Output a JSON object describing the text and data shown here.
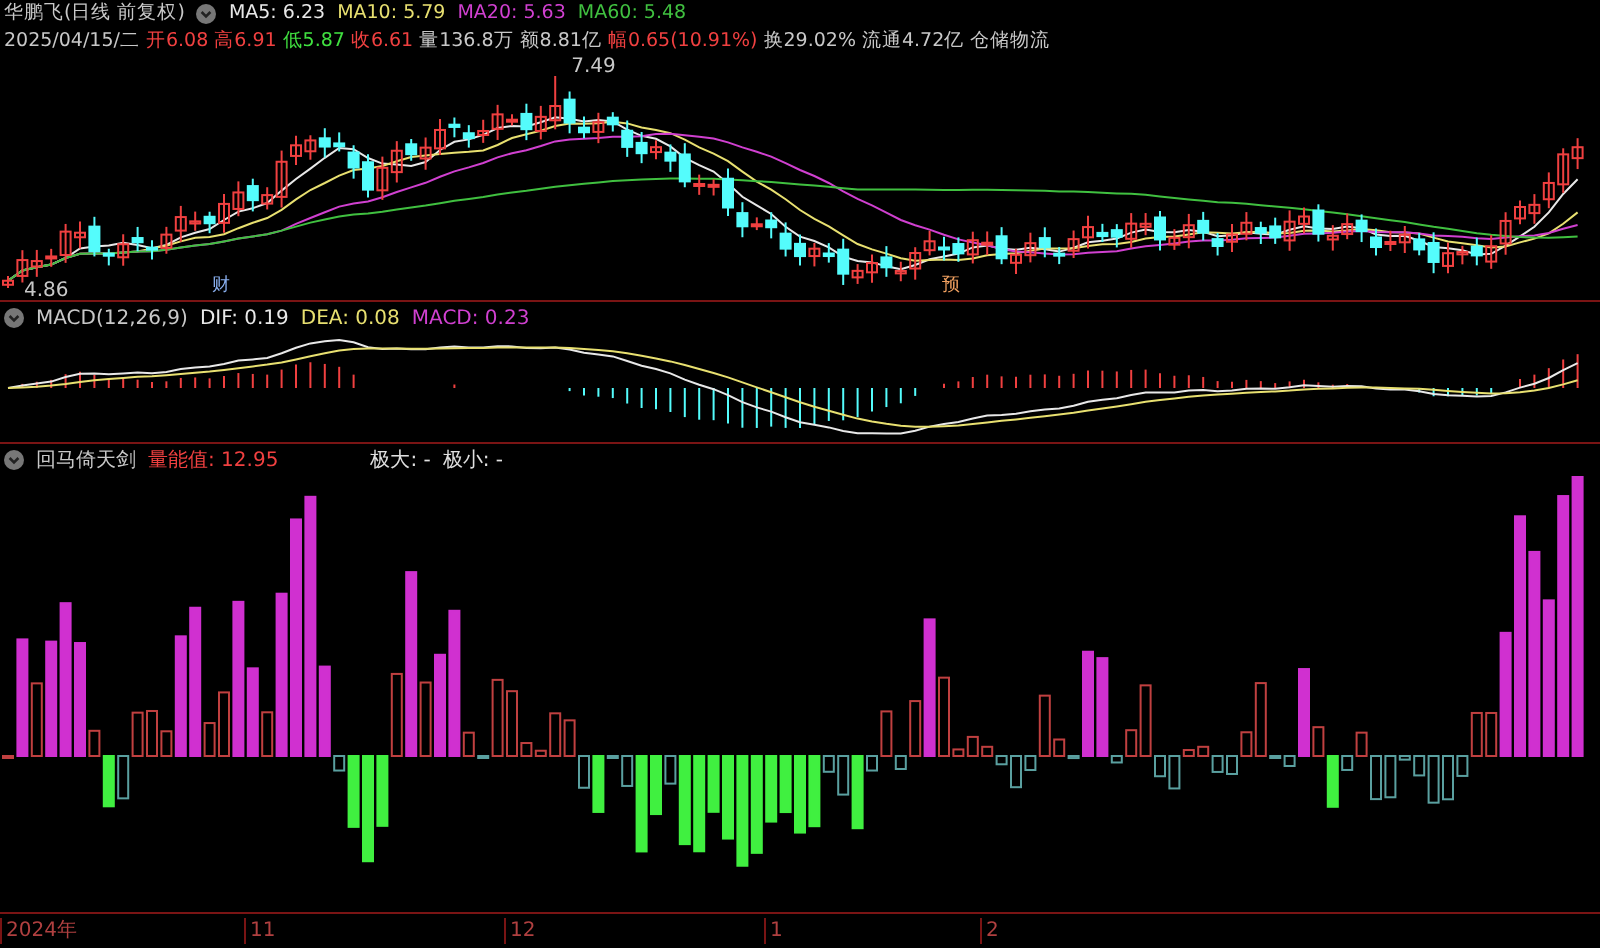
{
  "title": {
    "name": "华鹏飞",
    "period": "(日线 前复权)"
  },
  "ma": [
    {
      "label": "MA5: 6.23",
      "color": "#e8e8e8"
    },
    {
      "label": "MA10: 5.79",
      "color": "#e8e070"
    },
    {
      "label": "MA20: 5.63",
      "color": "#d040d0"
    },
    {
      "label": "MA60: 5.48",
      "color": "#40c040"
    }
  ],
  "quote": [
    {
      "label": "2025/04/15/二",
      "color": "#c8c8c8"
    },
    {
      "label": "开6.08",
      "color": "#f04040"
    },
    {
      "label": "高6.91",
      "color": "#f04040"
    },
    {
      "label": "低5.87",
      "color": "#40e040"
    },
    {
      "label": "收6.61",
      "color": "#f04040"
    },
    {
      "label": "量136.8万",
      "color": "#c8c8c8"
    },
    {
      "label": "额8.81亿",
      "color": "#c8c8c8"
    },
    {
      "label": "幅0.65(10.91%)",
      "color": "#f04040"
    },
    {
      "label": "换29.02%",
      "color": "#c8c8c8"
    },
    {
      "label": "流通4.72亿",
      "color": "#c8c8c8"
    },
    {
      "label": "仓储物流",
      "color": "#c8c8c8"
    }
  ],
  "price_chart": {
    "high_label": "7.49",
    "low_label": "4.86",
    "event_markers": [
      "财",
      "预"
    ]
  },
  "macd": {
    "name": "MACD(12,26,9)",
    "values": [
      {
        "label": "DIF: 0.19",
        "color": "#e8e8e8"
      },
      {
        "label": "DEA: 0.08",
        "color": "#e8e070"
      },
      {
        "label": "MACD: 0.23",
        "color": "#d040d0"
      }
    ]
  },
  "indicator": {
    "name": "回马倚天剑",
    "value_label": "量能值: 12.95",
    "max_label": "极大: -",
    "min_label": "极小: -"
  },
  "time_axis": [
    "2024年",
    "11",
    "12",
    "1",
    "2"
  ]
}
